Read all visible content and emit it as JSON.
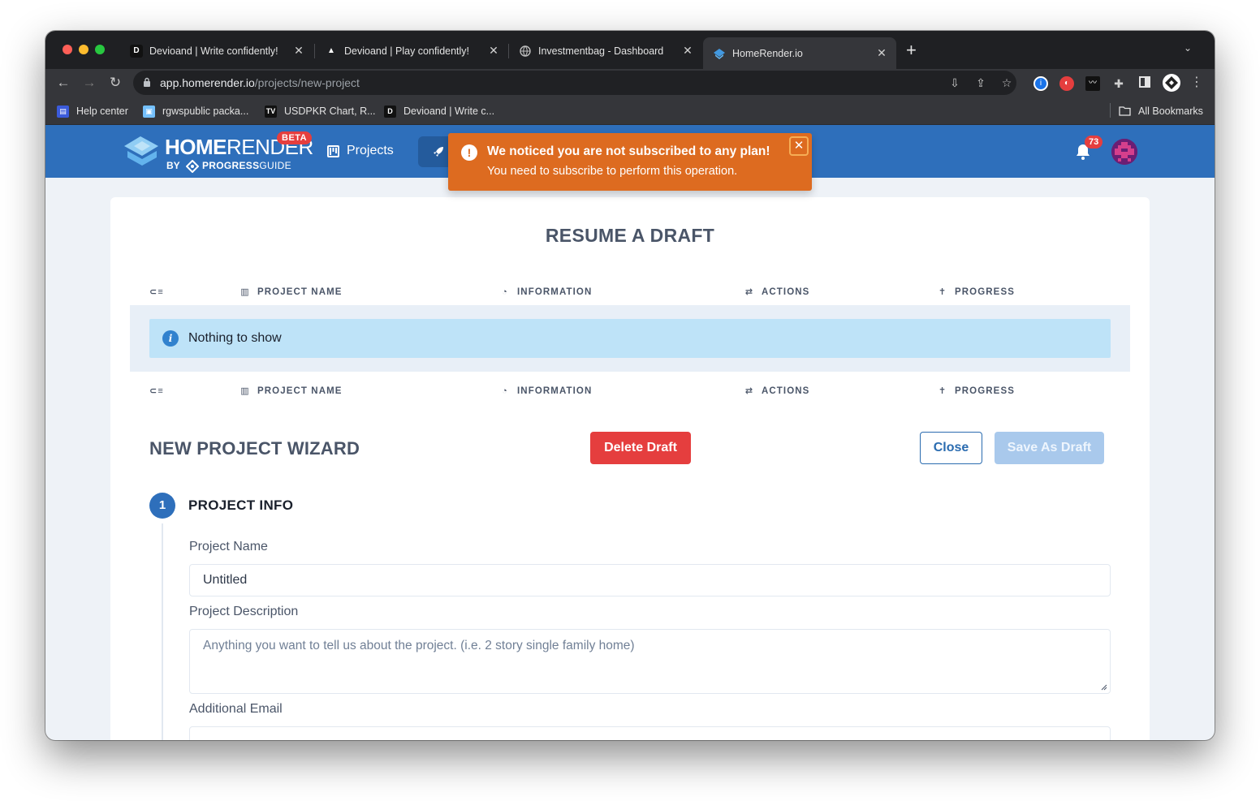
{
  "browser": {
    "tabs": [
      {
        "title": "Devioand | Write confidently!",
        "favicon": "D",
        "favicon_color": "#1f1f1f"
      },
      {
        "title": "Devioand | Play confidently!",
        "favicon": "▲",
        "favicon_color": "#1f1f1f"
      },
      {
        "title": "Investmentbag - Dashboard",
        "favicon": "globe-icon",
        "favicon_color": "#9aa0a6"
      },
      {
        "title": "HomeRender.io",
        "favicon": "homerender-icon",
        "favicon_color": "#4299e1",
        "active": true
      }
    ],
    "new_tab": "+",
    "url_domain": "app.homerender.io",
    "url_path": "/projects/new-project",
    "bookmarks": [
      {
        "label": "Help center",
        "icon": "help-center-icon"
      },
      {
        "label": "rgwspublic packa...",
        "icon": "package-icon"
      },
      {
        "label": "USDPKR Chart, R...",
        "icon": "tradingview-icon"
      },
      {
        "label": "Devioand | Write c...",
        "icon": "devioand-icon"
      }
    ],
    "all_bookmarks": "All Bookmarks"
  },
  "app": {
    "logo_home": "HOME",
    "logo_render": "RENDER",
    "logo_by": "BY",
    "logo_progress": "PROGRESS",
    "logo_guide": "GUIDE",
    "beta": "BETA",
    "nav_projects": "Projects",
    "notification_count": "73",
    "colors": {
      "brand": "#2e6fbb",
      "warning": "#dd6b20",
      "danger": "#e53e3e"
    }
  },
  "toast": {
    "title": "We noticed you are not subscribed to any plan!",
    "message": "You need to subscribe to perform this operation."
  },
  "drafts": {
    "title": "RESUME A DRAFT",
    "columns": [
      "PROJECT NAME",
      "INFORMATION",
      "ACTIONS",
      "PROGRESS"
    ],
    "empty_message": "Nothing to show"
  },
  "wizard": {
    "title": "NEW PROJECT WIZARD",
    "delete_label": "Delete Draft",
    "close_label": "Close",
    "save_label": "Save As Draft",
    "step_number": "1",
    "step_title": "PROJECT INFO",
    "name_label": "Project Name",
    "name_value": "Untitled",
    "description_label": "Project Description",
    "description_placeholder": "Anything you want to tell us about the project. (i.e. 2 story single family home)",
    "email_label": "Additional Email"
  }
}
